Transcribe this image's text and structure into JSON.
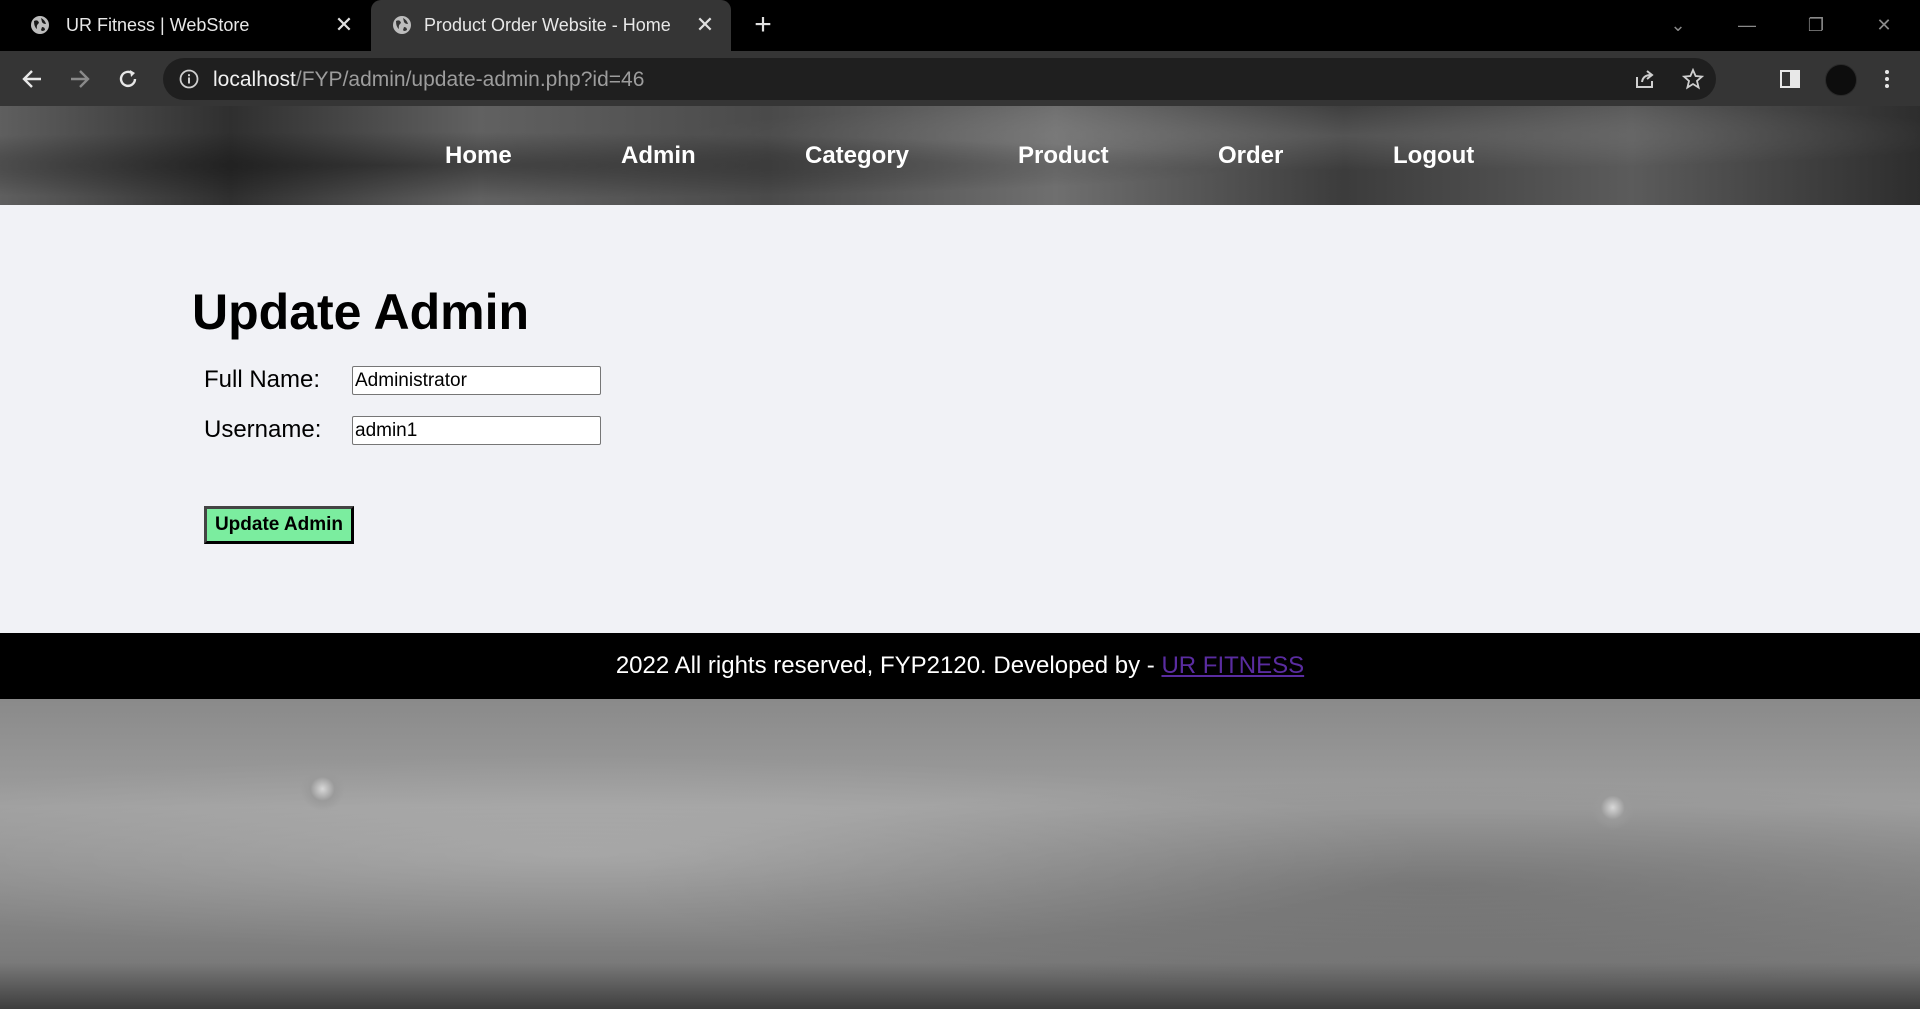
{
  "browser": {
    "tabs": [
      {
        "title": "UR Fitness | WebStore",
        "active": false
      },
      {
        "title": "Product Order Website - Home Page",
        "active": true
      }
    ],
    "url_host": "localhost",
    "url_path": "/FYP/admin/update-admin.php?id=46"
  },
  "nav": {
    "items": [
      "Home",
      "Admin",
      "Category",
      "Product",
      "Order",
      "Logout"
    ]
  },
  "form": {
    "title": "Update Admin",
    "full_name_label": "Full Name:",
    "full_name_value": "Administrator",
    "username_label": "Username:",
    "username_value": "admin1",
    "submit_label": "Update Admin"
  },
  "footer": {
    "text": "2022 All rights reserved, FYP2120. Developed by - ",
    "link_text": "UR FITNESS",
    "link_color": "#5a2ca0"
  },
  "colors": {
    "submit_bg": "#7bed9f",
    "content_bg": "#f1f2f6"
  }
}
